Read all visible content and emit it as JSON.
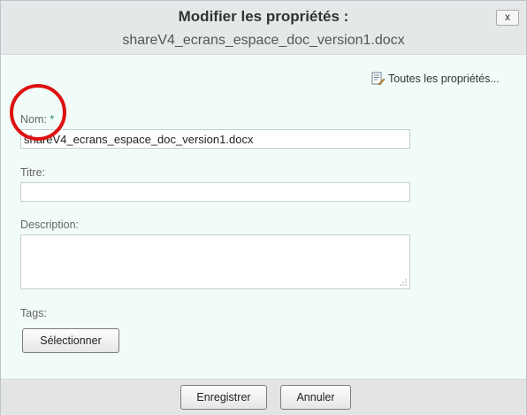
{
  "dialog": {
    "title": "Modifier les propriétés :",
    "filename": "shareV4_ecrans_espace_doc_version1.docx",
    "close_label": "x"
  },
  "all_properties_link": "Toutes les propriétés...",
  "fields": {
    "name": {
      "label": "Nom:",
      "required_marker": "*",
      "value": "shareV4_ecrans_espace_doc_version1.docx"
    },
    "title": {
      "label": "Titre:",
      "value": ""
    },
    "description": {
      "label": "Description:",
      "value": ""
    },
    "tags": {
      "label": "Tags:",
      "select_label": "Sélectionner"
    }
  },
  "footer": {
    "save_label": "Enregistrer",
    "cancel_label": "Annuler"
  },
  "colors": {
    "annotation_circle": "#dd1111"
  }
}
